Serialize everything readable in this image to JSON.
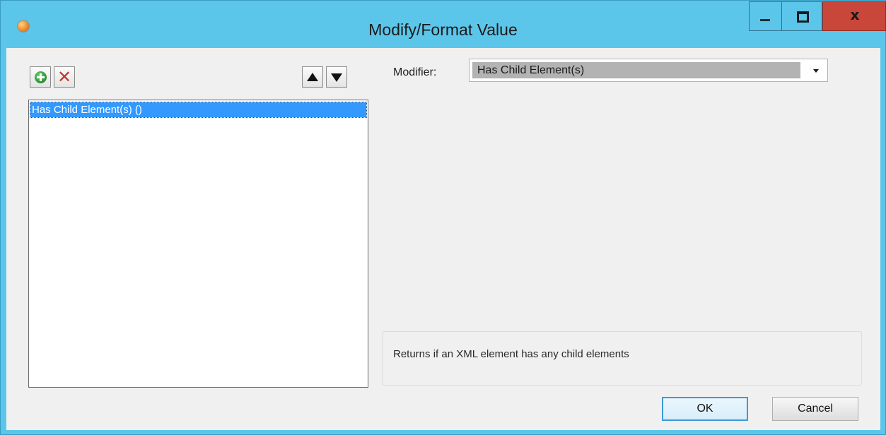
{
  "window": {
    "title": "Modify/Format Value",
    "icon": "app-orb-icon",
    "controls": {
      "minimize": "minimize-icon",
      "maximize": "maximize-icon",
      "close_label": "x"
    }
  },
  "toolbar": {
    "add_icon": "add-circle-icon",
    "delete_icon": "delete-x-icon",
    "delete_glyph": "✕",
    "move_up_icon": "triangle-up-icon",
    "move_down_icon": "triangle-down-icon"
  },
  "modifier_list": {
    "items": [
      {
        "label": "Has Child Element(s) ()",
        "selected": true
      }
    ]
  },
  "modifier": {
    "label": "Modifier:",
    "selected_value": "Has Child Element(s)"
  },
  "description": {
    "text": "Returns if an XML element has any child elements"
  },
  "buttons": {
    "ok": "OK",
    "cancel": "Cancel"
  },
  "colors": {
    "titlebar": "#5cc6ea",
    "close_button": "#c8473a",
    "selection": "#3399ff",
    "dialog_background": "#f0f0f0"
  }
}
